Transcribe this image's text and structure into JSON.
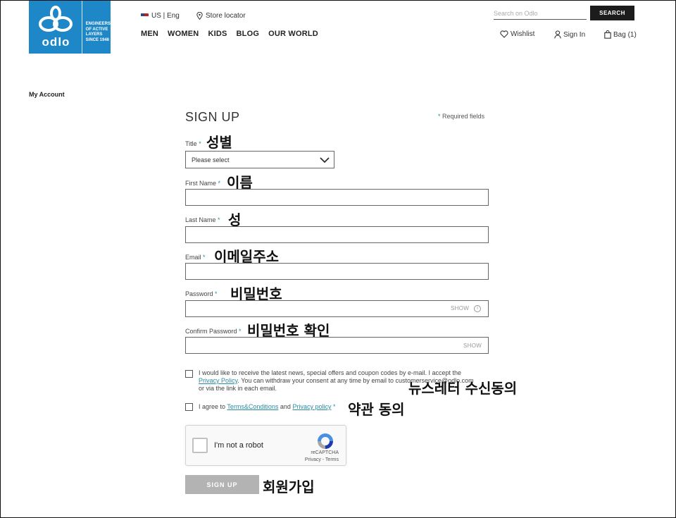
{
  "header": {
    "logo_word": "odlo",
    "logo_tagline": [
      "Engineers",
      "of active",
      "layers",
      "since 1946"
    ],
    "locale": "US | Eng",
    "store_locator": "Store locator",
    "nav": [
      "MEN",
      "WOMEN",
      "KIDS",
      "BLOG",
      "OUR WORLD"
    ],
    "search_placeholder": "Search on Odlo",
    "search_button": "SEARCH",
    "wishlist": "Wishlist",
    "sign_in": "Sign In",
    "bag": "Bag (1)"
  },
  "sidebar": {
    "my_account": "My Account"
  },
  "form": {
    "title": "SIGN UP",
    "required_star": "*",
    "required_note": "Required fields",
    "title_label": "Title",
    "title_select": "Please select",
    "first_name_label": "First Name",
    "last_name_label": "Last Name",
    "email_label": "Email",
    "password_label": "Password",
    "password_show": "SHOW",
    "confirm_password_label": "Confirm Password",
    "confirm_show": "SHOW",
    "consent_text_1": "I would like to receive the latest news, special offers and coupon codes by e-mail. I accept the",
    "consent_link": "Privacy Policy",
    "consent_text_2": ". You can withdraw your consent at any time by email to customerservice@odlo.com or via the link in each email.",
    "agree_text_1": "I agree to",
    "agree_link_1": "Terms&Conditions",
    "agree_text_2": "and",
    "agree_link_2": "Privacy policy",
    "submit": "SIGN UP"
  },
  "recaptcha": {
    "label": "I'm not a robot",
    "brand": "reCAPTCHA",
    "links": "Privacy - Terms"
  },
  "annotations": {
    "title": "성별",
    "first_name": "이름",
    "last_name": "성",
    "email": "이메일주소",
    "password": "비밀번호",
    "confirm_password": "비밀번호 확인",
    "newsletter": "뉴스레터 수신동의",
    "terms": "약관 동의",
    "submit": "회원가입"
  },
  "colors": {
    "brand": "#1e87c8",
    "accent": "#2a8aa0",
    "button_disabled": "#b3b3b3"
  }
}
